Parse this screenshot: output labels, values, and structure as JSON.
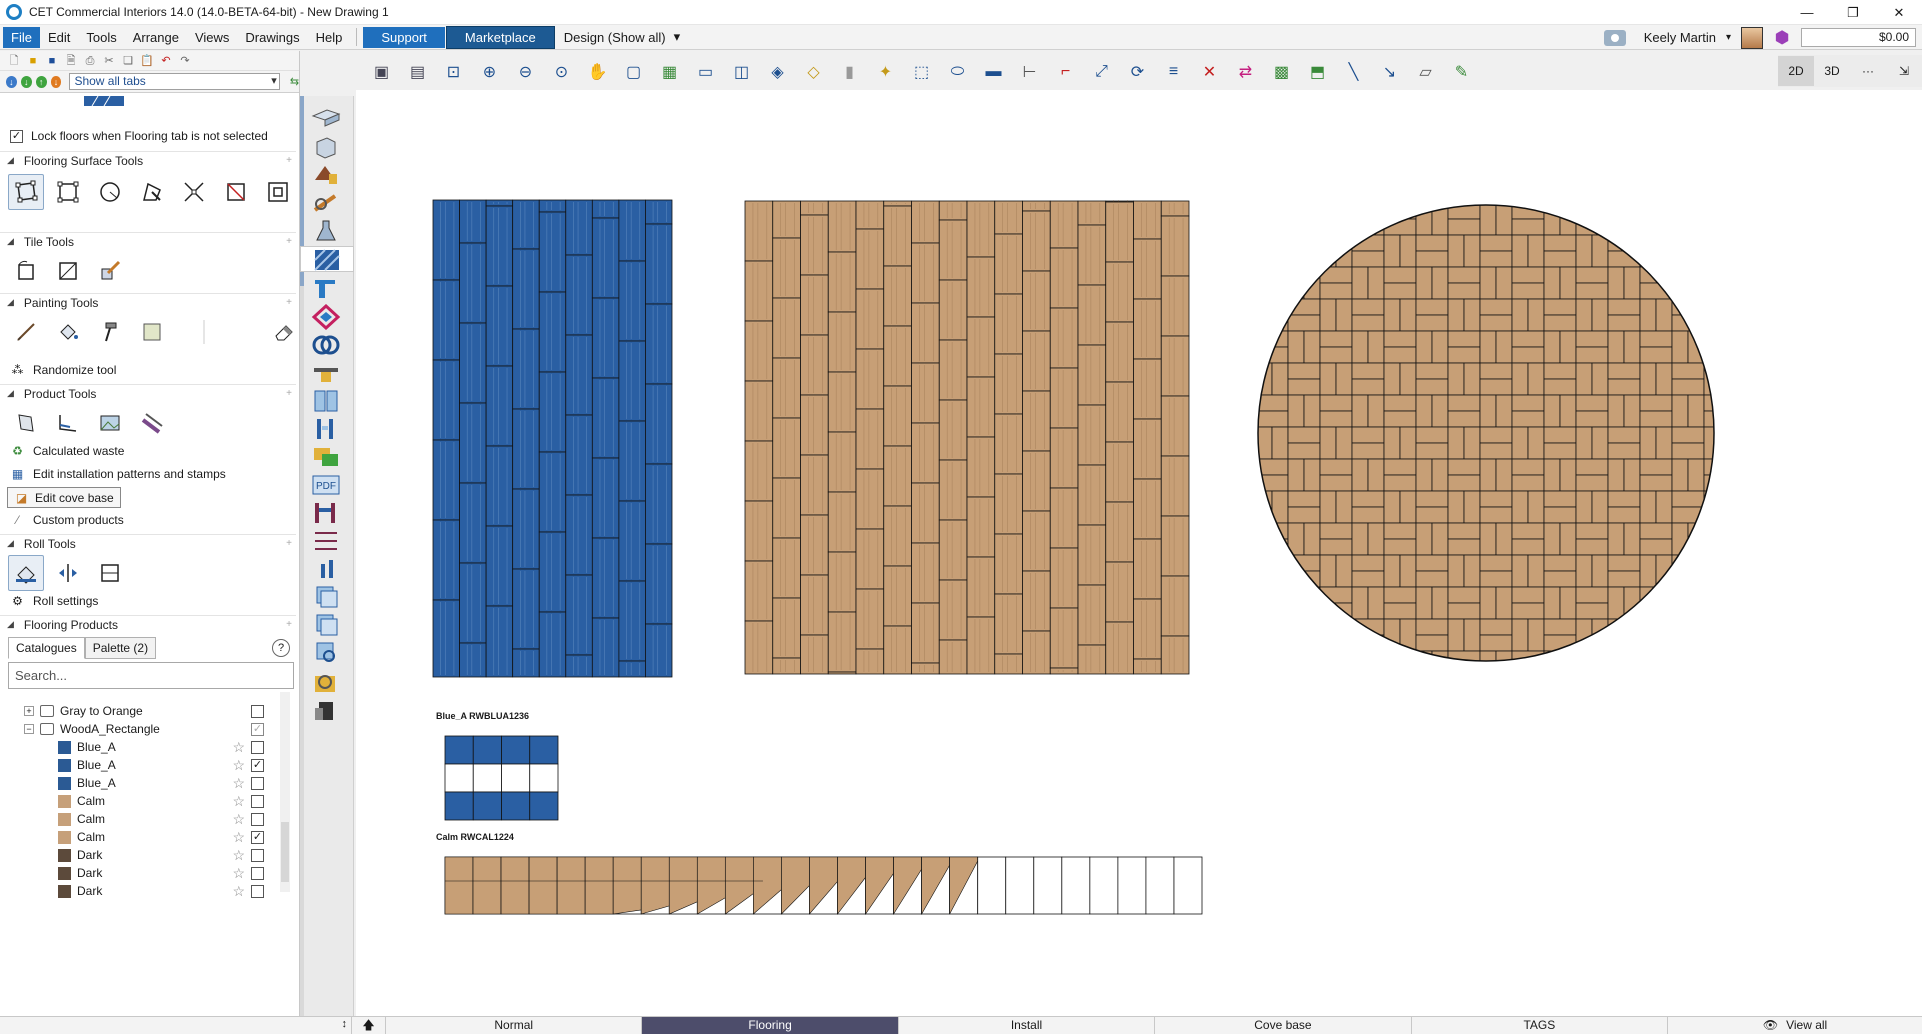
{
  "window": {
    "title": "CET Commercial Interiors 14.0 (14.0-BETA-64-bit) - New Drawing 1"
  },
  "menu": {
    "items": [
      "File",
      "Edit",
      "Tools",
      "Arrange",
      "Views",
      "Drawings",
      "Help"
    ],
    "support": "Support",
    "marketplace": "Marketplace",
    "design": "Design (Show all)",
    "user": "Keely Martin",
    "price": "$0.00"
  },
  "left": {
    "tab_selector": "Show all tabs",
    "lock_floors": "Lock floors when Flooring tab is not selected",
    "sections": {
      "surface": "Flooring Surface Tools",
      "tile": "Tile Tools",
      "painting": "Painting Tools",
      "product": "Product Tools",
      "roll": "Roll Tools",
      "flooring_products": "Flooring Products"
    },
    "links": {
      "randomize": "Randomize tool",
      "waste": "Calculated waste",
      "patterns": "Edit installation patterns and stamps",
      "cove": "Edit cove base",
      "custom": "Custom products",
      "roll_settings": "Roll settings"
    },
    "product_tabs": [
      "Catalogues",
      "Palette (2)"
    ],
    "search_placeholder": "Search...",
    "tree": [
      {
        "label": "Gray to Orange",
        "kind": "folder",
        "expander": "+",
        "checked": false
      },
      {
        "label": "WoodA_Rectangle",
        "kind": "folder",
        "expander": "−",
        "checked": "grey"
      },
      {
        "label": "Blue_A",
        "kind": "item",
        "color": "#2b5a94",
        "checked": false
      },
      {
        "label": "Blue_A",
        "kind": "item",
        "color": "#2b5a94",
        "checked": true
      },
      {
        "label": "Blue_A",
        "kind": "item",
        "color": "#2b5a94",
        "checked": false
      },
      {
        "label": "Calm",
        "kind": "item",
        "color": "#c6a07a",
        "checked": false
      },
      {
        "label": "Calm",
        "kind": "item",
        "color": "#c6a07a",
        "checked": false
      },
      {
        "label": "Calm",
        "kind": "item",
        "color": "#c6a07a",
        "checked": true
      },
      {
        "label": "Dark",
        "kind": "item",
        "color": "#5c4a3b",
        "checked": false
      },
      {
        "label": "Dark",
        "kind": "item",
        "color": "#5c4a3b",
        "checked": false
      },
      {
        "label": "Dark",
        "kind": "item",
        "color": "#5c4a3b",
        "checked": false
      }
    ]
  },
  "canvas": {
    "label_blue": "Blue_A RWBLUA1236",
    "label_calm": "Calm RWCAL1224",
    "colors": {
      "blue": "#2a5fa3",
      "wood": "#c79f76"
    }
  },
  "view_buttons": [
    "2D",
    "3D",
    "···",
    "⇲"
  ],
  "bottom": {
    "tabs": [
      "Normal",
      "Flooring",
      "Install",
      "Cove base",
      "TAGS"
    ],
    "active_tab": "Flooring",
    "view_all": "View all"
  },
  "colors": {
    "accent": "#1f6fbd",
    "active_tab": "#4d4d6b"
  }
}
